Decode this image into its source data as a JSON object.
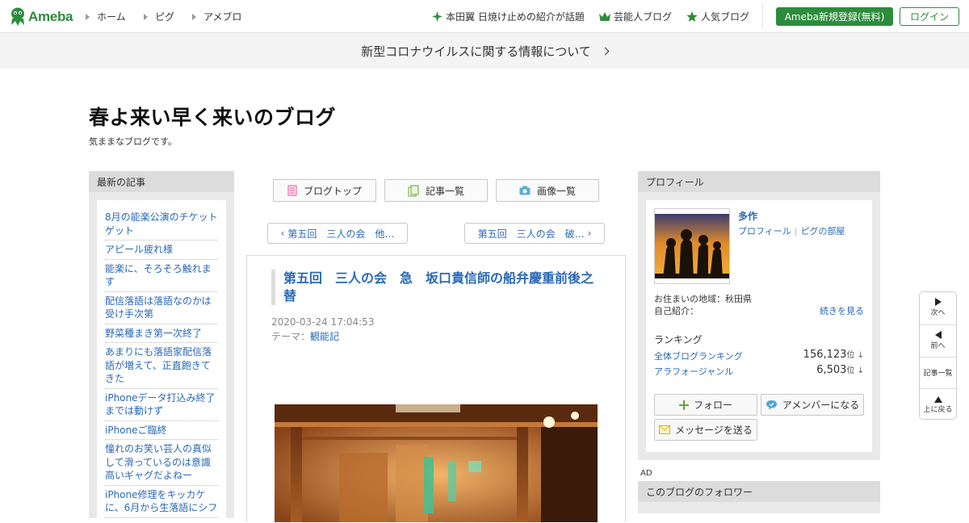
{
  "header": {
    "logo_text": "Ameba",
    "nav": [
      "ホーム",
      "ピグ",
      "アメブロ"
    ],
    "trend_link": "本田翼 日焼け止めの紹介が話題",
    "celeb_link": "芸能人ブログ",
    "popular_link": "人気ブログ",
    "signup_label": "Ameba新規登録(無料)",
    "login_label": "ログイン"
  },
  "banner": {
    "text": "新型コロナウイルスに関する情報について"
  },
  "blog": {
    "title": "春よ来い早く来いのブログ",
    "description": "気ままなブログです。"
  },
  "left_sidebar": {
    "heading": "最新の記事",
    "items": [
      "8月の能楽公演のチケットゲット",
      "アピール疲れ様",
      "能楽に、そろそろ触れます",
      "配信落語は落語なのかは受け手次第",
      "野菜種まき第一次終了",
      "あまりにも落語家配信落語が増えて、正直飽きてきた",
      "iPhoneデータ打込み終了までは動けず",
      "iPhoneご臨終",
      "憧れのお笑い芸人の真似して滑っているのは意識高いギャグだよねー",
      "iPhone修理をキッカケに、6月から生落語にシフ"
    ]
  },
  "center": {
    "buttons": {
      "top": "ブログトップ",
      "list": "記事一覧",
      "images": "画像一覧"
    },
    "prev_article": "第五回　三人の会　他…",
    "next_article": "第五回　三人の会　破…",
    "article": {
      "title": "第五回　三人の会　急　坂口貴信師の船弁慶重前後之替",
      "date": "2020-03-24 17:04:53",
      "theme_prefix": "テーマ：",
      "theme": "観能記"
    }
  },
  "profile": {
    "heading": "プロフィール",
    "name": "多作",
    "link_profile": "プロフィール",
    "link_pig": "ピグの部屋",
    "area": "お住まいの地域：秋田県",
    "intro_label": "自己紹介：",
    "more": "続きを見る",
    "ranking_heading": "ランキング",
    "rankings": [
      {
        "label": "全体ブログランキング",
        "value": "156,123",
        "unit": "位 ↓"
      },
      {
        "label": "アラフォージャンル",
        "value": "6,503",
        "unit": "位 ↓"
      }
    ],
    "follow_label": "フォロー",
    "amember_label": "アメンバーになる",
    "message_label": "メッセージを送る"
  },
  "ad_label": "AD",
  "followers": {
    "heading": "このブログのフォロワー"
  },
  "sidenav": {
    "next": "次へ",
    "prev": "前へ",
    "list": "記事一覧",
    "top": "上に戻る"
  },
  "colors": {
    "brand_green": "#2d8c3c",
    "link_blue": "#2a69b8"
  }
}
